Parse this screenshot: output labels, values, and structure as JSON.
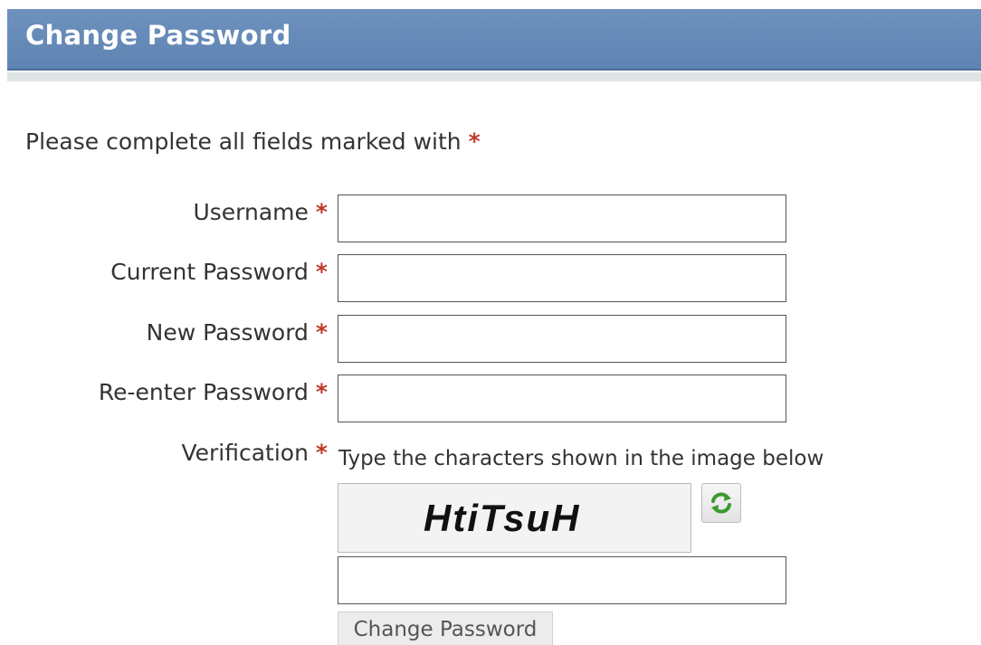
{
  "header": {
    "title": "Change Password"
  },
  "form": {
    "instructions": "Please complete all fields marked with",
    "required_marker": "*",
    "fields": [
      {
        "label": "Username",
        "value": "",
        "placeholder": ""
      },
      {
        "label": "Current Password",
        "value": "",
        "placeholder": ""
      },
      {
        "label": "New Password",
        "value": "",
        "placeholder": ""
      },
      {
        "label": "Re-enter Password",
        "value": "",
        "placeholder": ""
      }
    ],
    "verification": {
      "label": "Verification",
      "hint": "Type the characters shown in the image below",
      "captcha_text": "HtiTsuH",
      "refresh_icon": "refresh-icon",
      "input_value": ""
    },
    "submit_label": "Change Password"
  },
  "colors": {
    "header_bg": "#6287b6",
    "required": "#c0392b",
    "refresh_icon": "#3a9a2e"
  }
}
